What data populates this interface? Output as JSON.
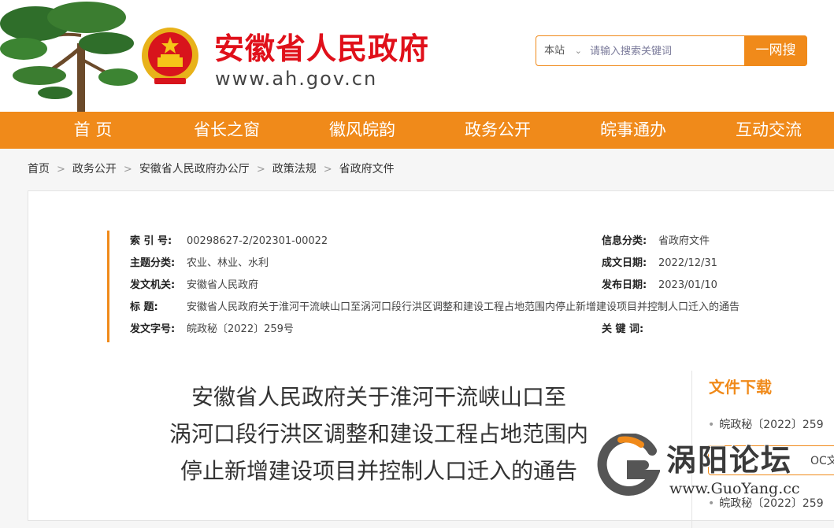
{
  "header": {
    "site_title": "安徽省人民政府",
    "site_url": "www.ah.gov.cn",
    "search": {
      "scope": "本站",
      "placeholder": "请输入搜索关键词",
      "button": "一网搜"
    }
  },
  "nav": {
    "items": [
      {
        "label": "首 页"
      },
      {
        "label": "省长之窗"
      },
      {
        "label": "徽风皖韵"
      },
      {
        "label": "政务公开"
      },
      {
        "label": "皖事通办"
      },
      {
        "label": "互动交流"
      }
    ]
  },
  "breadcrumb": [
    "首页",
    "政务公开",
    "安徽省人民政府办公厅",
    "政策法规",
    "省政府文件"
  ],
  "meta": {
    "index_label": "索 引 号:",
    "index_value": "00298627-2/202301-00022",
    "topic_label": "主题分类:",
    "topic_value": "农业、林业、水利",
    "issuer_label": "发文机关:",
    "issuer_value": "安徽省人民政府",
    "title_label": "标    题:",
    "title_value": "安徽省人民政府关于淮河干流峡山口至涡河口段行洪区调整和建设工程占地范围内停止新增建设项目并控制人口迁入的通告",
    "docno_label": "发文字号:",
    "docno_value": "皖政秘〔2022〕259号",
    "category_label": "信息分类:",
    "category_value": "省政府文件",
    "created_label": "成文日期:",
    "created_value": "2022/12/31",
    "published_label": "发布日期:",
    "published_value": "2023/01/10",
    "keywords_label": "关 键 词:",
    "keywords_value": ""
  },
  "document": {
    "title_lines": [
      "安徽省人民政府关于淮河干流峡山口至",
      "涡河口段行洪区调整和建设工程占地范围内",
      "停止新增建设项目并控制人口迁入的通告"
    ]
  },
  "sidebar": {
    "heading": "文件下载",
    "downloads": [
      {
        "label": "皖政秘〔2022〕259"
      },
      {
        "label": "OC文件下"
      },
      {
        "label": "皖政秘〔2022〕259"
      }
    ]
  },
  "watermark": {
    "name": "涡阳论坛",
    "url": "www.GuoYang.cc"
  },
  "colors": {
    "accent": "#f08a1a",
    "title_red": "#e0101a"
  }
}
